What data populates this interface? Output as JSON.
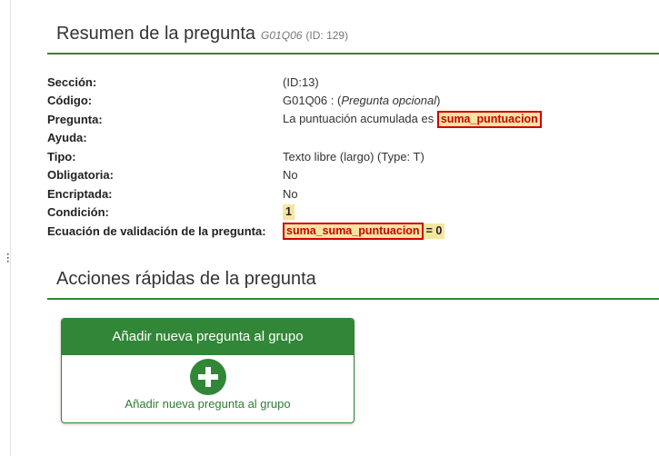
{
  "summary": {
    "title": "Resumen de la pregunta",
    "code": "G01Q06",
    "id": "(ID: 129)",
    "rows": {
      "section": {
        "label": "Sección:",
        "value": "(ID:13)"
      },
      "code": {
        "label": "Código:",
        "value_prefix": "G01Q06 : (",
        "value_italic": "Pregunta opcional",
        "value_suffix": ")"
      },
      "question": {
        "label": "Pregunta:",
        "value": "La puntuación acumulada es",
        "var": "suma_puntuacion"
      },
      "help": {
        "label": "Ayuda:",
        "value": ""
      },
      "type": {
        "label": "Tipo:",
        "value": "Texto libre (largo) (Type: T)"
      },
      "mandatory": {
        "label": "Obligatoria:",
        "value": "No"
      },
      "encrypted": {
        "label": "Encriptada:",
        "value": "No"
      },
      "condition": {
        "label": "Condición:",
        "value": "1"
      },
      "validation": {
        "label": "Ecuación de validación de la pregunta:",
        "var": "suma_suma_puntuacion",
        "rest": "= 0"
      }
    }
  },
  "actions": {
    "title": "Acciones rápidas de la pregunta",
    "card": {
      "header": "Añadir nueva pregunta al grupo",
      "icon": "plus-circle-icon",
      "link": "Añadir nueva pregunta al grupo"
    }
  },
  "colors": {
    "accent": "#328637",
    "highlight": "#f5e5a3",
    "error": "#d00000"
  }
}
